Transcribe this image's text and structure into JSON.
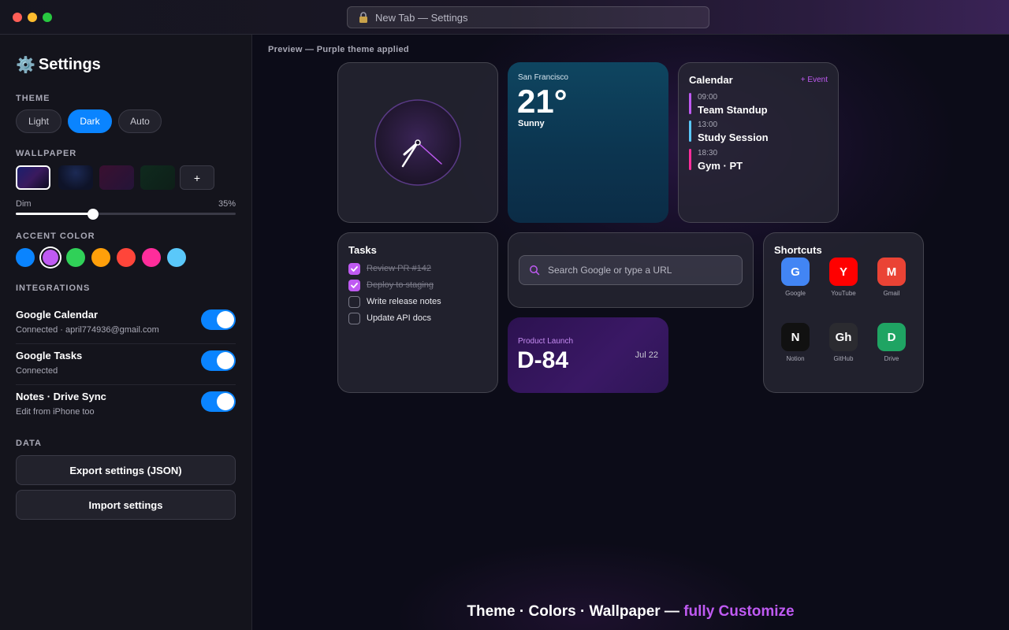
{
  "window": {
    "address_bar_text": "New Tab — Settings"
  },
  "sidebar": {
    "title": "Settings",
    "theme": {
      "label": "THEME",
      "options": [
        "Light",
        "Dark",
        "Auto"
      ],
      "selected": "Dark"
    },
    "wallpaper": {
      "label": "WALLPAPER",
      "add_label": "+",
      "dim_label": "Dim",
      "dim_value_text": "35%",
      "dim_value": 35
    },
    "accent": {
      "label": "ACCENT COLOR",
      "colors": [
        "#0a84ff",
        "#bf5af2",
        "#30d158",
        "#ff9f0a",
        "#ff453a",
        "#ff2d9b",
        "#5ac8fa"
      ],
      "selected": "#bf5af2"
    },
    "integrations": {
      "label": "INTEGRATIONS",
      "items": [
        {
          "name": "Google Calendar",
          "status": "Connected · april774936@gmail.com",
          "enabled": true
        },
        {
          "name": "Google Tasks",
          "status": "Connected",
          "enabled": true
        },
        {
          "name": "Notes · Drive Sync",
          "status": "Edit from iPhone too",
          "enabled": true
        }
      ]
    },
    "data": {
      "label": "DATA",
      "export_label": "Export settings (JSON)",
      "import_label": "Import settings"
    }
  },
  "preview": {
    "label": "Preview — Purple theme applied",
    "weather": {
      "city": "San Francisco",
      "temp": "21°",
      "condition": "Sunny"
    },
    "calendar": {
      "title": "Calendar",
      "add_label": "+ Event",
      "events": [
        {
          "time": "09:00",
          "title": "Team Standup",
          "color": "#bf5af2"
        },
        {
          "time": "13:00",
          "title": "Study Session",
          "color": "#5ac8fa"
        },
        {
          "time": "18:30",
          "title": "Gym · PT",
          "color": "#ff2d9b"
        }
      ]
    },
    "tasks": {
      "title": "Tasks",
      "items": [
        {
          "label": "Review PR #142",
          "done": true
        },
        {
          "label": "Deploy to staging",
          "done": true
        },
        {
          "label": "Write release notes",
          "done": false
        },
        {
          "label": "Update API docs",
          "done": false
        }
      ]
    },
    "search": {
      "placeholder": "Search Google or type a URL"
    },
    "dday": {
      "label": "Product Launch",
      "value": "D-84",
      "date": "Jul 22"
    },
    "shortcuts": {
      "title": "Shortcuts",
      "items": [
        {
          "letter": "G",
          "label": "Google",
          "color": "#4285f4"
        },
        {
          "letter": "Y",
          "label": "YouTube",
          "color": "#ff0000"
        },
        {
          "letter": "M",
          "label": "Gmail",
          "color": "#ea4335"
        },
        {
          "letter": "N",
          "label": "Notion",
          "color": "#111111"
        },
        {
          "letter": "Gh",
          "label": "GitHub",
          "color": "#2b2b30"
        },
        {
          "letter": "D",
          "label": "Drive",
          "color": "#1fa463"
        }
      ]
    },
    "tagline": {
      "main": "Theme · Colors · Wallpaper — ",
      "highlight": "fully Customize"
    }
  }
}
